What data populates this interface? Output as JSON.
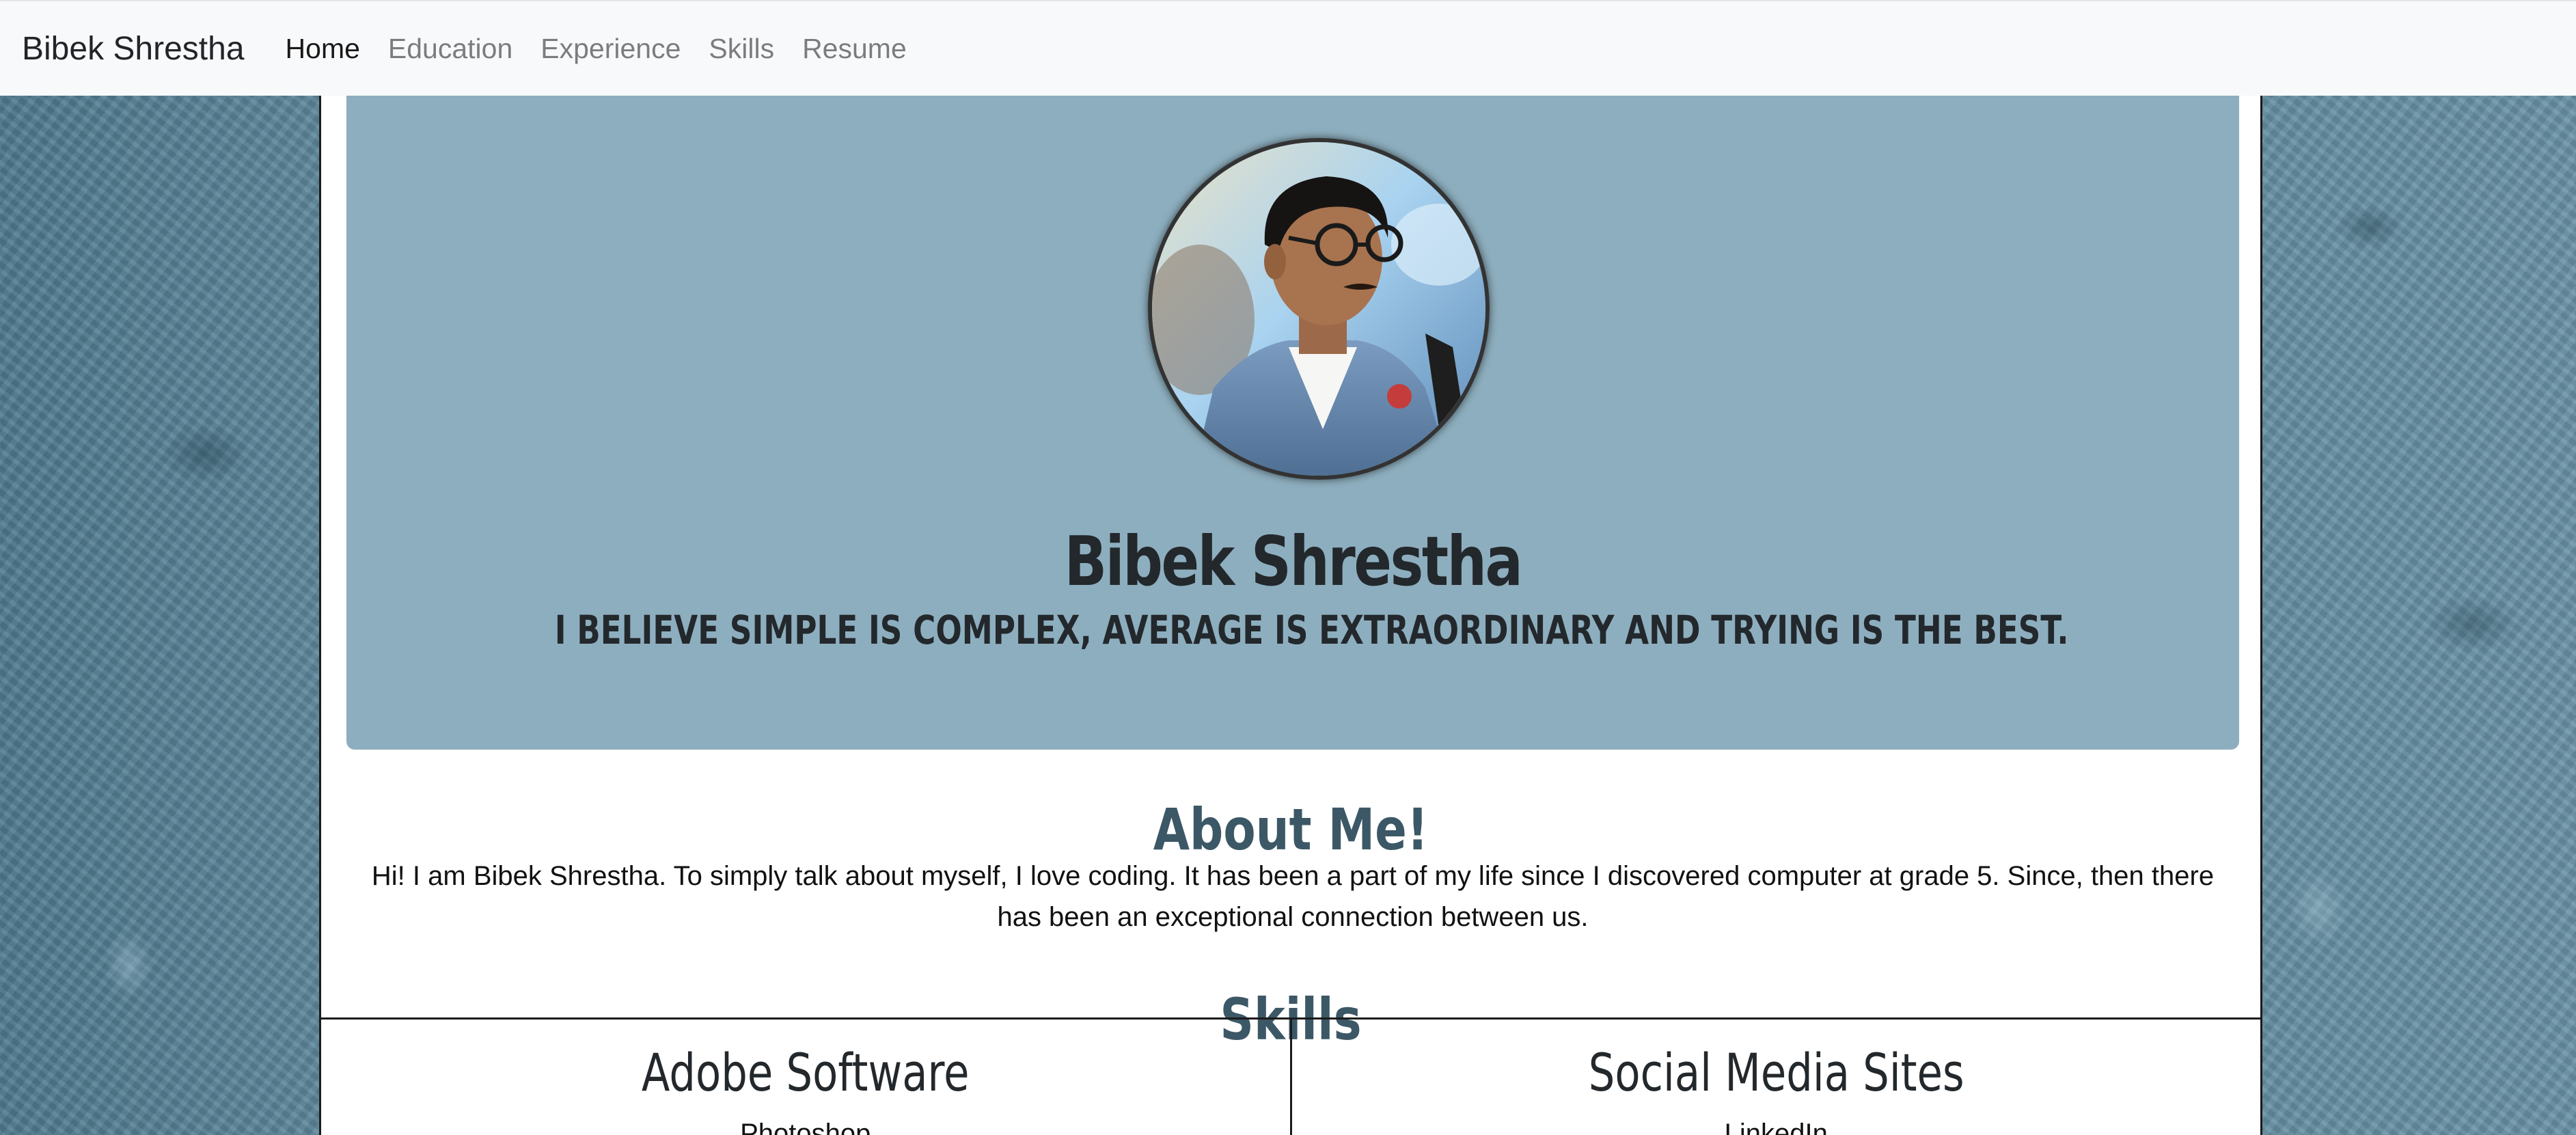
{
  "navbar": {
    "brand": "Bibek Shrestha",
    "links": [
      {
        "label": "Home",
        "active": true
      },
      {
        "label": "Education",
        "active": false
      },
      {
        "label": "Experience",
        "active": false
      },
      {
        "label": "Skills",
        "active": false
      },
      {
        "label": "Resume",
        "active": false
      }
    ]
  },
  "hero": {
    "name": "Bibek Shrestha",
    "quote": "I BELIEVE SIMPLE IS COMPLEX, AVERAGE IS EXTRAORDINARY AND TRYING IS THE BEST.",
    "avatar_icon": "profile-photo"
  },
  "about": {
    "title": "About Me!",
    "text": "Hi! I am Bibek Shrestha. To simply talk about myself, I love coding. It has been a part of my life since I discovered computer at grade 5. Since, then there has been an exceptional connection between us."
  },
  "skills": {
    "title": "Skills",
    "columns": [
      {
        "heading": "Adobe Software",
        "first_item": "Photoshop"
      },
      {
        "heading": "Social Media Sites",
        "first_item": "LinkedIn"
      }
    ]
  },
  "colors": {
    "navbar_bg": "#f8f9fa",
    "jumbotron_bg": "#8daebe",
    "section_title": "#3c5866",
    "page_bg": "#5a8296"
  }
}
